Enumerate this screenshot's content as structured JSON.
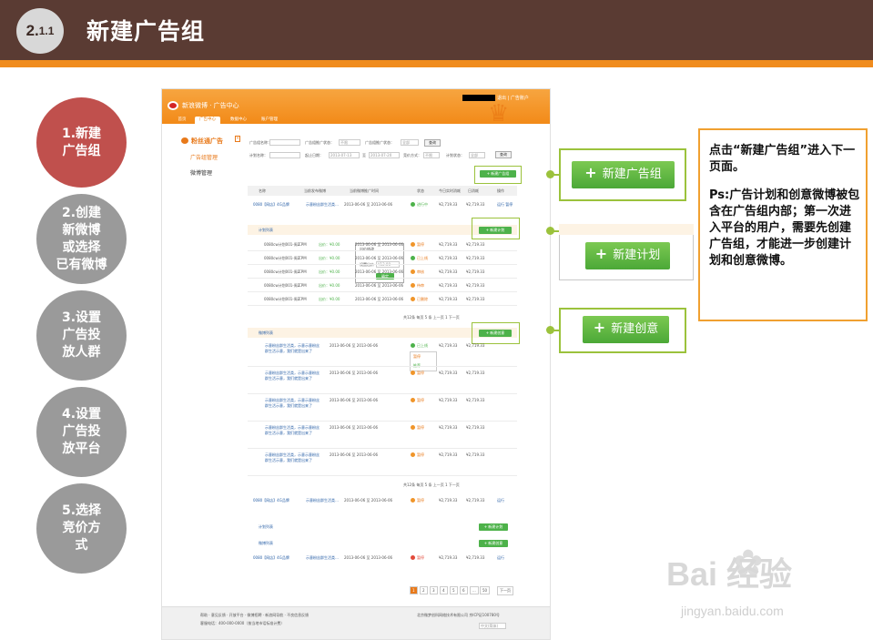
{
  "slide": {
    "section_number": "2.",
    "section_sub": "1.1",
    "title": "新建广告组"
  },
  "steps": [
    {
      "label": "1.新建\n广告组",
      "active": true
    },
    {
      "label": "2.创建\n新微博\n或选择\n已有微博",
      "active": false
    },
    {
      "label": "3.设置\n广告投\n放人群",
      "active": false
    },
    {
      "label": "4.设置\n广告投\n放平台",
      "active": false
    },
    {
      "label": "5.选择\n竞价方\n式",
      "active": false
    }
  ],
  "app": {
    "brand": "新浪微博 · 广告中心",
    "account_text": "退出 | 广告账户",
    "nav": [
      "首页",
      "广告中心",
      "数据中心",
      "账户管理"
    ],
    "side_brand": "粉丝通广告",
    "side_collapse": "«",
    "side_items": [
      "广告组管理",
      "微博管理"
    ],
    "filters": {
      "row1": [
        "广告组名称：",
        "广告组推广状态：",
        "不限",
        "广告组推广状态：",
        "全部",
        "查询"
      ],
      "row2": [
        "计划名称：",
        "起止日期：",
        "2013-07-13",
        "至",
        "2013-07-20",
        "竞价方式：",
        "不限",
        "计划状态：",
        "全部",
        "查询"
      ]
    },
    "new_group_button": "+ 新建广告组",
    "table_headers": [
      "名称",
      "当前发布微博",
      "当前微博推广时间",
      "状态",
      "今日实时消耗",
      "日消耗",
      "操作"
    ],
    "group_rows": [
      {
        "name": "0080【网店】4G品牌",
        "weibo": "示意粉丝群生活类…",
        "period": "2013-06-06 至 2013-06-06",
        "status": "进行中",
        "spend": "¥2,719.33",
        "daily": "¥2,719.33",
        "op": "运行 暂停"
      },
      {
        "name": "0080【网店】4G品牌",
        "weibo": "示意粉丝群生活类…",
        "period": "2013-06-06 至 2013-06-06",
        "status": "暂停",
        "spend": "¥2,719.33",
        "daily": "¥2,719.33",
        "op": "运行"
      },
      {
        "name": "0080【网店】4G品牌",
        "weibo": "示意粉丝群生活类…",
        "period": "2013-06-06 至 2013-06-06",
        "status": "暂停",
        "spend": "¥2,719.33",
        "daily": "¥2,719.33",
        "op": "运行"
      }
    ],
    "plan_list_label": "计划列表",
    "weibo_list_label": "微博列表",
    "new_plan_button": "+ 新建计划",
    "new_creative_button": "+ 新建创意",
    "plan_rows": [
      {
        "name": "0080cw计划001-周2",
        "bid": "CPM",
        "price": "出价：¥0.00",
        "period": "2013-06-06 至 2013-06-06",
        "status": "暂停",
        "spend": "¥2,719.33",
        "daily": "¥2,719.33"
      },
      {
        "name": "0080cw计划001-周2",
        "bid": "CPM",
        "price": "出价：¥0.00",
        "period": "2013-06-06 至 2013-06-06",
        "status": "已上线",
        "spend": "¥2,719.33",
        "daily": "¥2,719.33"
      },
      {
        "name": "0080cw计划001-周2",
        "bid": "CPM",
        "price": "出价：¥0.00",
        "period": "2013-06-06 至 2013-06-06",
        "status": "审核",
        "spend": "¥2,719.33",
        "daily": "¥2,719.33"
      },
      {
        "name": "0080cw计划001-周2",
        "bid": "CPM",
        "price": "出价：¥0.00",
        "period": "2013-06-06 至 2013-06-06",
        "status": "待审",
        "spend": "¥2,719.33",
        "daily": "¥2,719.33"
      },
      {
        "name": "0080cw计划001-周2",
        "bid": "CPM",
        "price": "出价：¥0.00",
        "period": "2013-06-06 至 2013-06-06",
        "status": "已删除",
        "spend": "¥2,719.33",
        "daily": "¥2,719.33"
      }
    ],
    "popup": {
      "title": "出价修改",
      "label": "设置出价",
      "value": "¥12.00",
      "button": "确定"
    },
    "weibo_rows": [
      {
        "text": "示意粉丝群生活类，示意示意粉丝群生活示意，我们就是出来了",
        "period": "2013-06-06 至 2013-06-06",
        "status": "已上线",
        "spend": "¥2,719.33",
        "daily": "¥2,719.33"
      },
      {
        "text": "示意粉丝群生活类，示意示意粉丝群生活示意，我们就是出来了",
        "period": "2013-06-06 至 2013-06-06",
        "status": "暂停",
        "spend": "¥2,719.33",
        "daily": "¥2,719.33"
      },
      {
        "text": "示意粉丝群生活类，示意示意粉丝群生活示意，我们就是出来了",
        "period": "2013-06-06 至 2013-06-06",
        "status": "暂停",
        "spend": "¥2,719.33",
        "daily": "¥2,719.33"
      },
      {
        "text": "示意粉丝群生活类，示意示意粉丝群生活示意，我们就是出来了",
        "period": "2013-06-06 至 2013-06-06",
        "status": "暂停",
        "spend": "¥2,719.33",
        "daily": "¥2,719.33"
      },
      {
        "text": "示意粉丝群生活类，示意示意粉丝群生活示意，我们就是出来了",
        "period": "2013-06-06 至 2013-06-06",
        "status": "暂停",
        "spend": "¥2,719.33",
        "daily": "¥2,719.33"
      }
    ],
    "dropdown_options": [
      "已上线",
      "暂停",
      "推荐"
    ],
    "pager_small": "共12条 每页 5 条   上一页 1 下一页",
    "pagination": [
      "1",
      "2",
      "3",
      "4",
      "5",
      "6",
      "...",
      "50",
      "下一页"
    ],
    "footer_links": "帮助 · 意见反馈 · 开放平台 · 微博招聘 · 新浪网导航 · 不良信息反馈",
    "footer_phone": "客服电话：400-000-0000（按当地市话标准计费）",
    "footer_right": "北京微梦创科网络技术有限公司 京ICP证100780号",
    "language": "中文(简体)"
  },
  "callouts": {
    "new_group": "新建广告组",
    "new_plan": "新建计划",
    "new_creative": "新建创意"
  },
  "note": {
    "line1": "点击“新建广告组”进入下一页面。",
    "line2": "Ps:广告计划和创意微博被包含在广告组内部；第一次进入平台的用户，需要先创建广告组，才能进一步创建计划和创意微博。"
  },
  "watermark": {
    "brand": "Bai 经验",
    "sub": "jingyan.baidu.com"
  },
  "colors": {
    "header": "#5a3b33",
    "accent_orange": "#f08c1e",
    "active_step": "#c0504d",
    "inactive_step": "#9a9a9a",
    "green": "#4db24a",
    "highlight": "#9bc23c"
  }
}
